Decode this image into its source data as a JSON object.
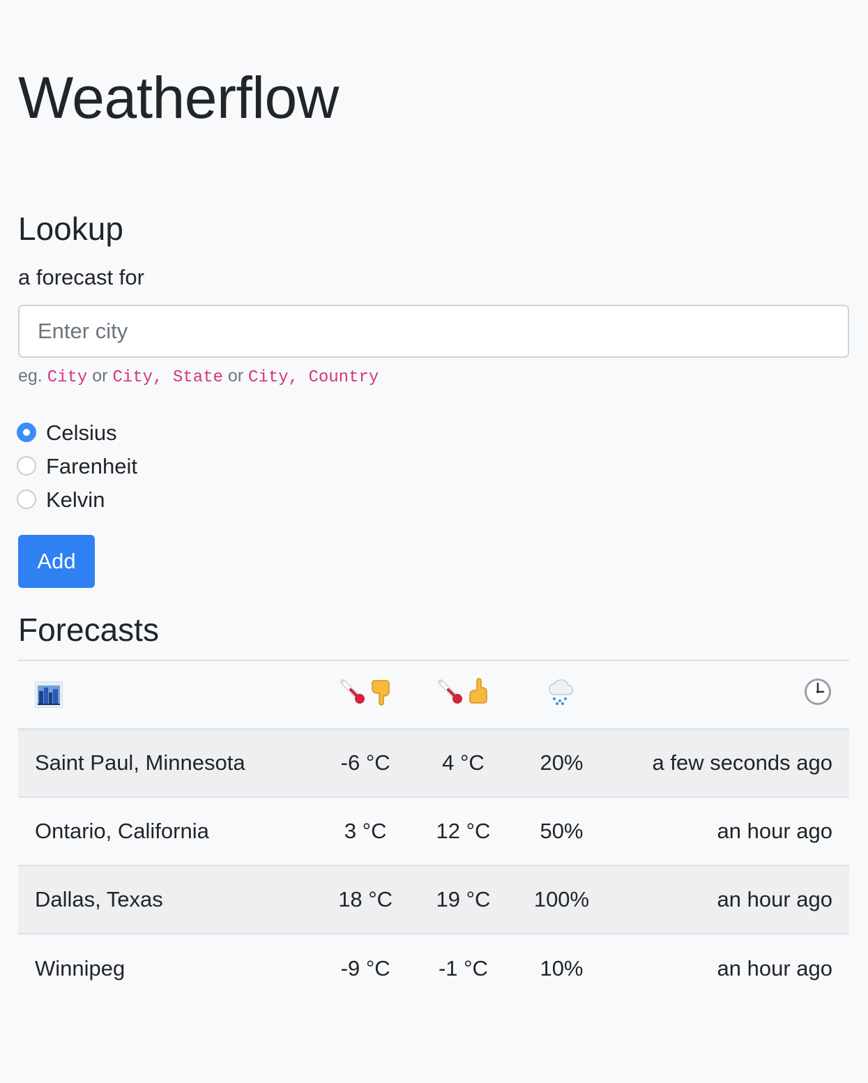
{
  "app": {
    "title": "Weatherflow"
  },
  "lookup": {
    "heading": "Lookup",
    "subheading": "a forecast for",
    "city_placeholder": "Enter city",
    "city_value": "",
    "hint_prefix": "eg.",
    "hint_example_1": "City",
    "hint_or_1": "or",
    "hint_example_2": "City, State",
    "hint_or_2": "or",
    "hint_example_3": "City, Country",
    "units": [
      {
        "label": "Celsius",
        "checked": true
      },
      {
        "label": "Farenheit",
        "checked": false
      },
      {
        "label": "Kelvin",
        "checked": false
      }
    ],
    "add_label": "Add"
  },
  "forecasts": {
    "heading": "Forecasts",
    "header_icons": [
      "city-skyline-icon",
      "thermometer-low-icon",
      "thermometer-high-icon",
      "rain-cloud-icon",
      "clock-icon"
    ],
    "rows": [
      {
        "city": "Saint Paul, Minnesota",
        "low": "-6 °C",
        "high": "4 °C",
        "precip": "20%",
        "updated": "a few seconds ago"
      },
      {
        "city": "Ontario, California",
        "low": "3 °C",
        "high": "12 °C",
        "precip": "50%",
        "updated": "an hour ago"
      },
      {
        "city": "Dallas, Texas",
        "low": "18 °C",
        "high": "19 °C",
        "precip": "100%",
        "updated": "an hour ago"
      },
      {
        "city": "Winnipeg",
        "low": "-9 °C",
        "high": "-1 °C",
        "precip": "10%",
        "updated": "an hour ago"
      }
    ]
  },
  "colors": {
    "background": "#f8f9fa",
    "primary": "#2f80f2",
    "code_pink": "#d63384",
    "stripe": "#eeeff0"
  }
}
